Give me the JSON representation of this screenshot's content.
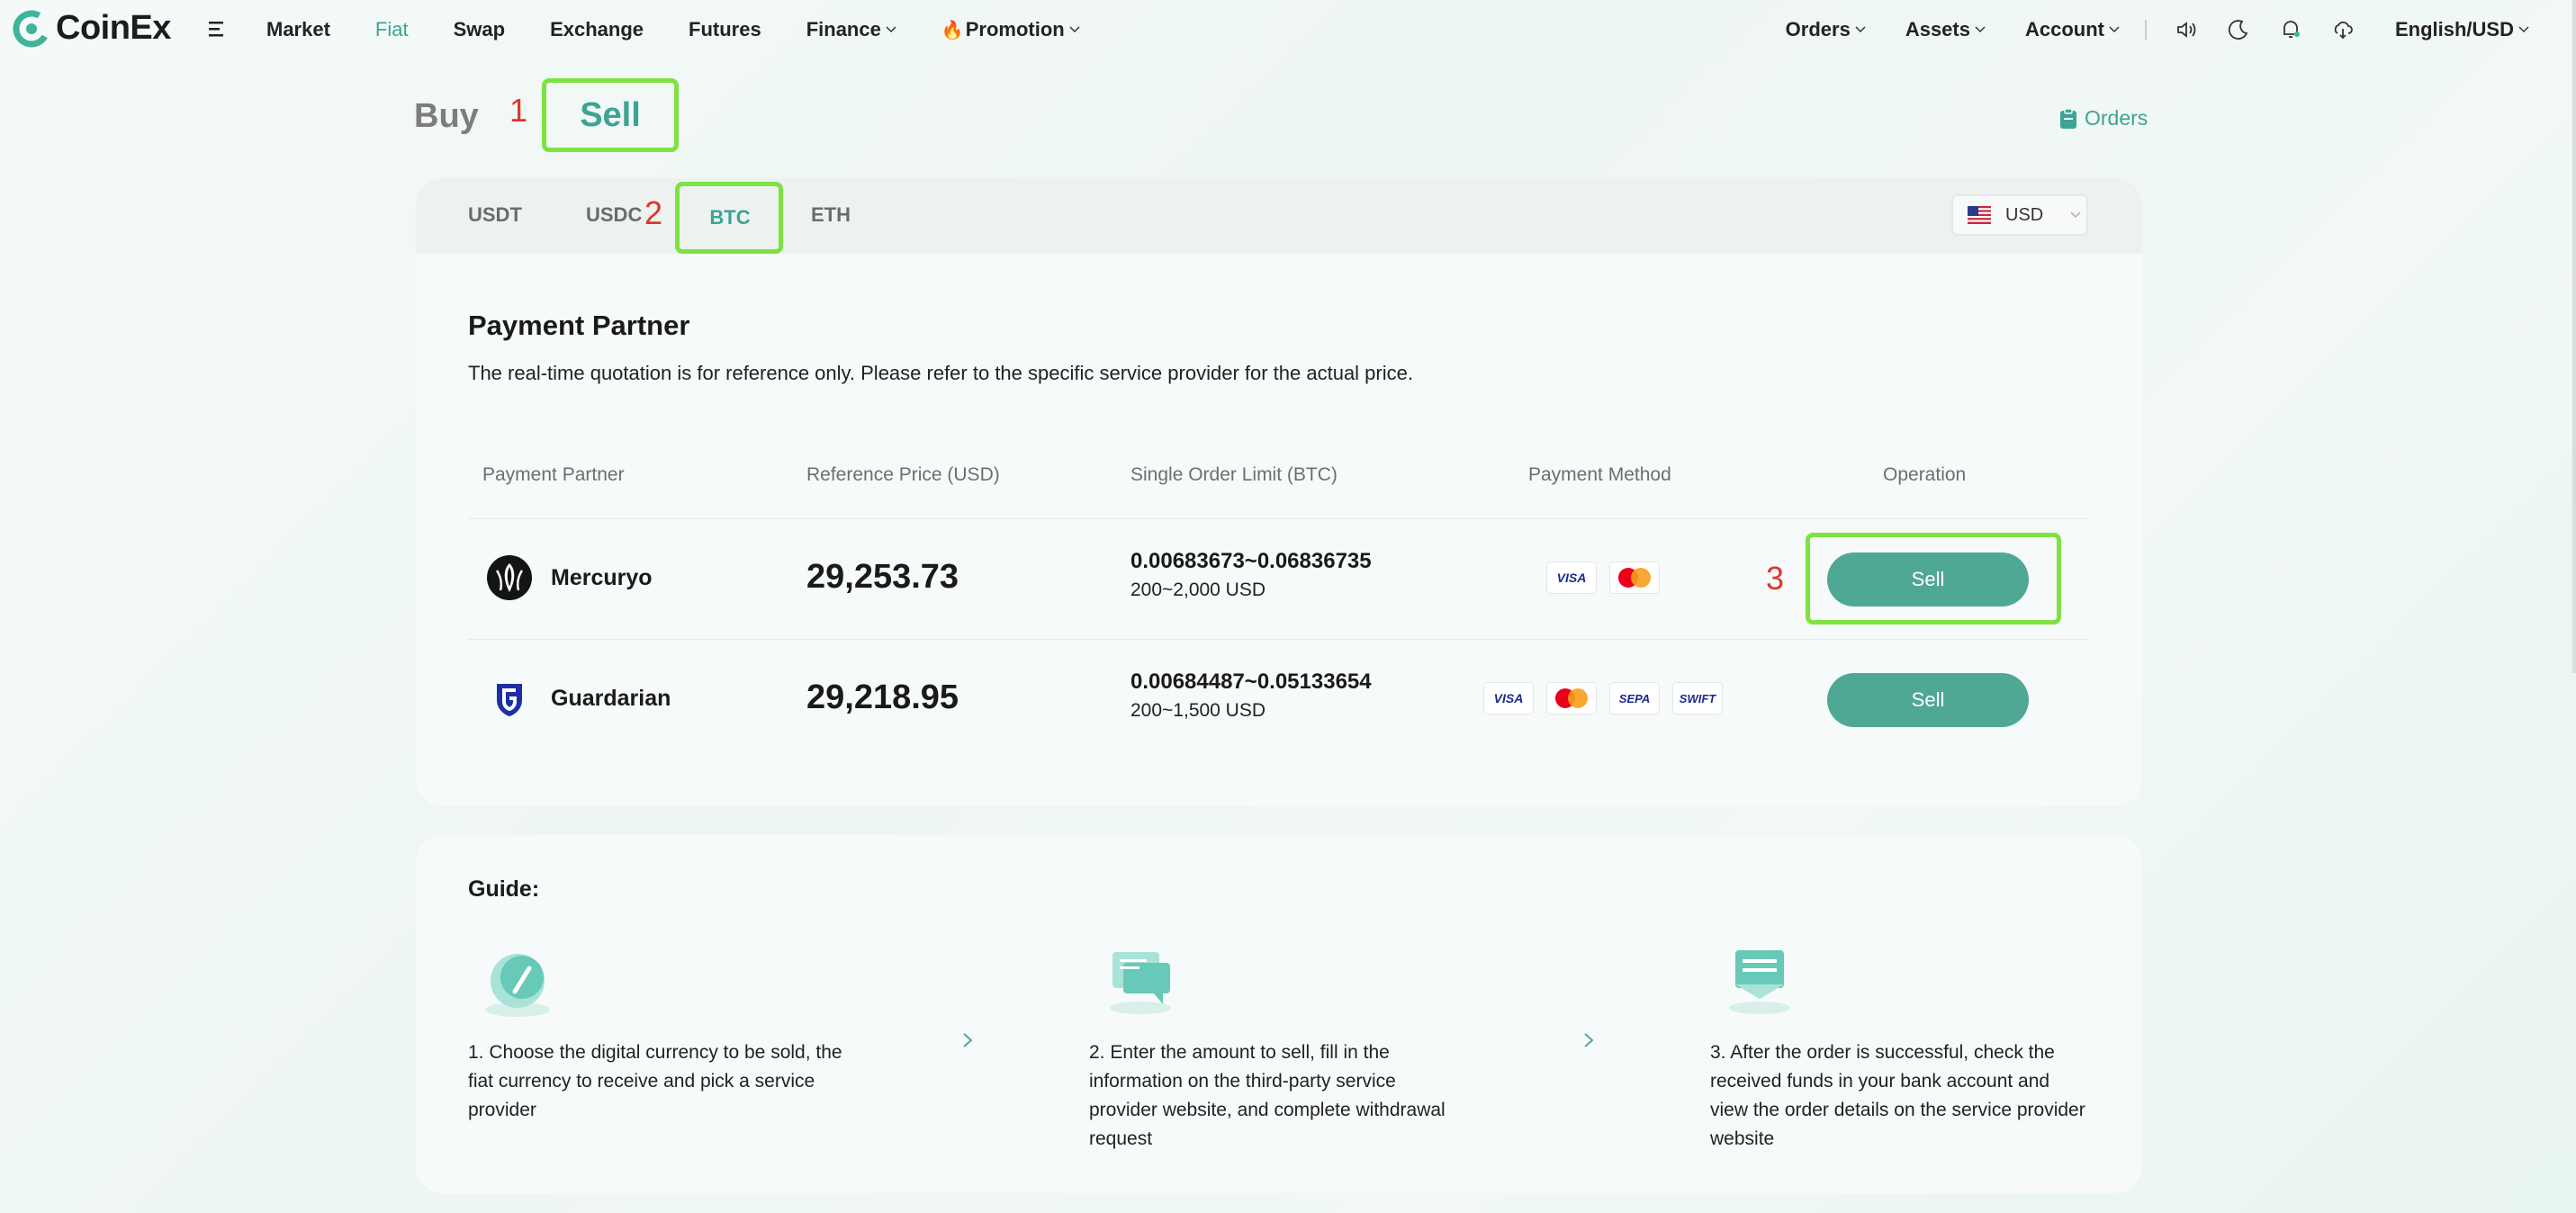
{
  "header": {
    "brand": "CoinEx",
    "nav_left": [
      "Market",
      "Fiat",
      "Swap",
      "Exchange",
      "Futures",
      "Finance",
      "Promotion"
    ],
    "active_nav": "Fiat",
    "nav_right": {
      "orders": "Orders",
      "assets": "Assets",
      "account": "Account",
      "language": "English/USD"
    },
    "icons": [
      "menu-icon",
      "speaker-icon",
      "moon-icon",
      "bell-icon",
      "download-icon"
    ]
  },
  "trade_mode": {
    "buy_label": "Buy",
    "sell_label": "Sell",
    "orders_link": "Orders"
  },
  "annotations": {
    "step1": "1",
    "step2": "2",
    "step3": "3",
    "highlight_color": "#7ee243",
    "number_color": "#e0352b"
  },
  "coin_tabs": [
    "USDT",
    "USDC",
    "BTC",
    "ETH"
  ],
  "selected_coin": "BTC",
  "currency_select": {
    "value": "USD"
  },
  "payment_partner": {
    "title": "Payment Partner",
    "description": "The real-time quotation is for reference only. Please refer to the specific service provider for the actual price.",
    "columns": [
      "Payment Partner",
      "Reference Price (USD)",
      "Single Order Limit (BTC)",
      "Payment Method",
      "Operation"
    ],
    "rows": [
      {
        "name": "Mercuryo",
        "price": "29,253.73",
        "limit_btc": "0.00683673~0.06836735",
        "limit_usd": "200~2,000 USD",
        "methods": [
          "VISA",
          "Mastercard"
        ],
        "action": "Sell"
      },
      {
        "name": "Guardarian",
        "price": "29,218.95",
        "limit_btc": "0.00684487~0.05133654",
        "limit_usd": "200~1,500 USD",
        "methods": [
          "VISA",
          "Mastercard",
          "SEPA",
          "SWIFT"
        ],
        "action": "Sell"
      }
    ]
  },
  "guide": {
    "title": "Guide:",
    "steps": [
      "1. Choose the digital currency to be sold, the fiat currency to receive and pick a service provider",
      "2. Enter the amount to sell, fill in the information on the third-party service provider website, and complete withdrawal request",
      "3. After the order is successful, check the received funds in your bank account and view the order details on the service provider website"
    ]
  },
  "colors": {
    "accent": "#3da494",
    "button": "#4fa893"
  }
}
